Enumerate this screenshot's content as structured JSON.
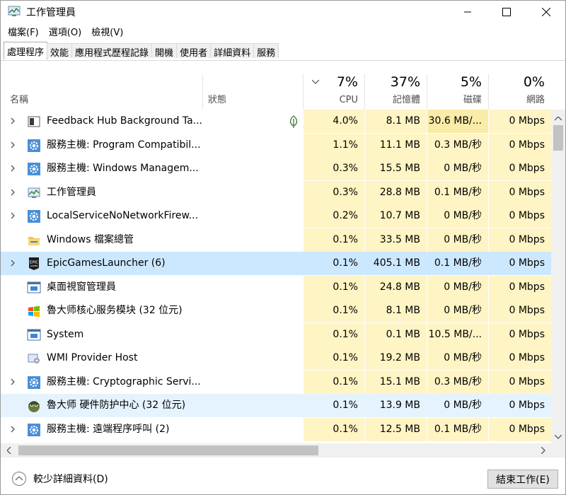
{
  "window": {
    "title": "工作管理員"
  },
  "menu": [
    "檔案(F)",
    "選項(O)",
    "檢視(V)"
  ],
  "tabs": [
    "處理程序",
    "效能",
    "應用程式歷程記錄",
    "開機",
    "使用者",
    "詳細資料",
    "服務"
  ],
  "header": {
    "name": "名稱",
    "status": "狀態",
    "cpu_pct": "7%",
    "cpu": "CPU",
    "mem_pct": "37%",
    "mem": "記憶體",
    "disk_pct": "5%",
    "disk": "磁碟",
    "net_pct": "0%",
    "net": "網路"
  },
  "rows": [
    {
      "name": "Feedback Hub Background Ta...",
      "icon": "feedback-hub-icon",
      "expand": true,
      "status_icon": "leaf-icon",
      "cpu": "4.0%",
      "mem": "8.1 MB",
      "disk": "30.6 MB/...",
      "net": "0 Mbps"
    },
    {
      "name": "服務主機: Program Compatibil...",
      "icon": "gear-icon",
      "expand": true,
      "cpu": "1.1%",
      "mem": "11.1 MB",
      "disk": "0.3 MB/秒",
      "net": "0 Mbps"
    },
    {
      "name": "服務主機: Windows Managem...",
      "icon": "gear-icon",
      "expand": true,
      "cpu": "0.3%",
      "mem": "15.5 MB",
      "disk": "0 MB/秒",
      "net": "0 Mbps"
    },
    {
      "name": "工作管理員",
      "icon": "task-manager-icon",
      "expand": true,
      "cpu": "0.3%",
      "mem": "28.8 MB",
      "disk": "0.1 MB/秒",
      "net": "0 Mbps"
    },
    {
      "name": "LocalServiceNoNetworkFirew...",
      "icon": "gear-icon",
      "expand": true,
      "cpu": "0.2%",
      "mem": "10.7 MB",
      "disk": "0 MB/秒",
      "net": "0 Mbps"
    },
    {
      "name": "Windows 檔案總管",
      "icon": "folder-icon",
      "expand": false,
      "cpu": "0.1%",
      "mem": "33.5 MB",
      "disk": "0 MB/秒",
      "net": "0 Mbps"
    },
    {
      "name": "EpicGamesLauncher (6)",
      "icon": "epic-games-icon",
      "expand": true,
      "cpu": "0.1%",
      "mem": "405.1 MB",
      "disk": "0.1 MB/秒",
      "net": "0 Mbps"
    },
    {
      "name": "桌面視窗管理員",
      "icon": "window-icon",
      "expand": false,
      "cpu": "0.1%",
      "mem": "24.8 MB",
      "disk": "0 MB/秒",
      "net": "0 Mbps"
    },
    {
      "name": "魯大师核心服务模块 (32 位元)",
      "icon": "windows-logo-icon",
      "expand": false,
      "cpu": "0.1%",
      "mem": "8.1 MB",
      "disk": "0 MB/秒",
      "net": "0 Mbps"
    },
    {
      "name": "System",
      "icon": "window-icon",
      "expand": false,
      "cpu": "0.1%",
      "mem": "0.1 MB",
      "disk": "10.5 MB/...",
      "net": "0 Mbps"
    },
    {
      "name": "WMI Provider Host",
      "icon": "wmi-icon",
      "expand": false,
      "cpu": "0.1%",
      "mem": "19.2 MB",
      "disk": "0 MB/秒",
      "net": "0 Mbps"
    },
    {
      "name": "服務主機: Cryptographic Servi...",
      "icon": "gear-icon",
      "expand": true,
      "cpu": "0.1%",
      "mem": "15.1 MB",
      "disk": "0.3 MB/秒",
      "net": "0 Mbps"
    },
    {
      "name": "魯大师 硬件防护中心 (32 位元)",
      "icon": "ludashi-icon",
      "expand": false,
      "cpu": "0.1%",
      "mem": "13.9 MB",
      "disk": "0 MB/秒",
      "net": "0 Mbps"
    },
    {
      "name": "服務主機: 遠端程序呼叫 (2)",
      "icon": "gear-icon",
      "expand": true,
      "cpu": "0.1%",
      "mem": "12.5 MB",
      "disk": "0.1 MB/秒",
      "net": "0 Mbps"
    }
  ],
  "selected_index": 6,
  "hover_index": 12,
  "footer": {
    "fewer_details": "較少詳細資料(D)",
    "end_task": "結束工作(E)"
  },
  "colors": {
    "heat_light": "#fff4c4",
    "heat_mid": "#f9eca8",
    "selection": "#cce8ff",
    "hover": "#e5f3ff"
  }
}
